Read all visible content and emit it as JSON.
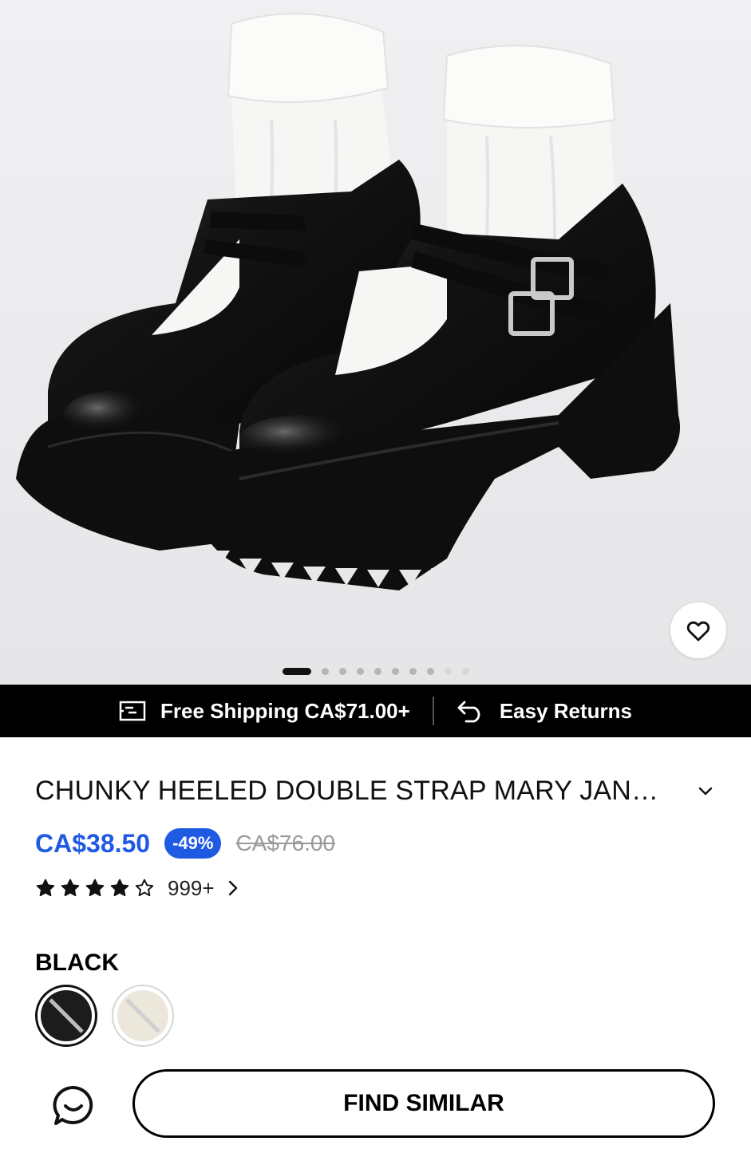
{
  "gallery": {
    "image_alt": "product-photo-black-mary-jane-shoes",
    "slide_count": 10,
    "active_slide": 1
  },
  "service_bar": {
    "shipping_label": "Free Shipping CA$71.00+",
    "returns_label": "Easy Returns"
  },
  "product": {
    "title": "CHUNKY HEELED DOUBLE STRAP MARY JANE SHOES",
    "price": "CA$38.50",
    "discount": "-49%",
    "original_price": "CA$76.00",
    "rating": 4,
    "rating_max": 5,
    "review_count": "999+"
  },
  "color": {
    "selected_label": "BLACK",
    "options": [
      {
        "name": "black",
        "hex": "#1c1c1c",
        "selected": true
      },
      {
        "name": "beige",
        "hex": "#ebe7da",
        "selected": false
      }
    ]
  },
  "bottom_bar": {
    "find_similar_label": "FIND SIMILAR"
  },
  "colors": {
    "accent": "#1f5ae3",
    "old_price": "#9a9a9a",
    "bar_bg": "#000000"
  }
}
